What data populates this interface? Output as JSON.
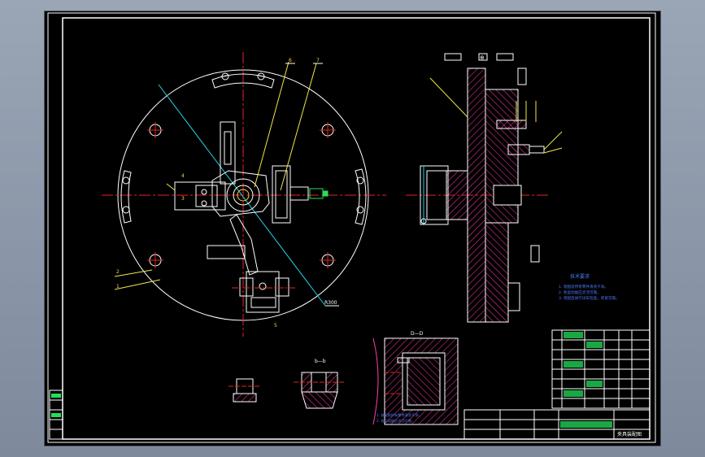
{
  "colors": {
    "background": "#000000",
    "outline": "#ffffff",
    "centerline": "#e8241c",
    "dimension": "#22d3e6",
    "leader": "#f2e64a",
    "hatch": "#ff3ea8",
    "balloon": "#ffd23c",
    "table": "#22e05a",
    "note": "#4d7cff"
  },
  "labels": {
    "section_marker": "⊕",
    "detail_view": "D—D",
    "detail_view_2": "b—b",
    "radius_note": "R300",
    "notes_title": "技术要求",
    "note_1": "1. 装配前所有零件清洗干净。",
    "note_2": "2. 各运动副应灵活可靠。",
    "note_3": "3. 装配后进行试车检查，夹紧可靠。",
    "title_block": "夹具装配图"
  },
  "balloons": [
    "1",
    "2",
    "3",
    "4",
    "5",
    "6",
    "7",
    "8"
  ]
}
